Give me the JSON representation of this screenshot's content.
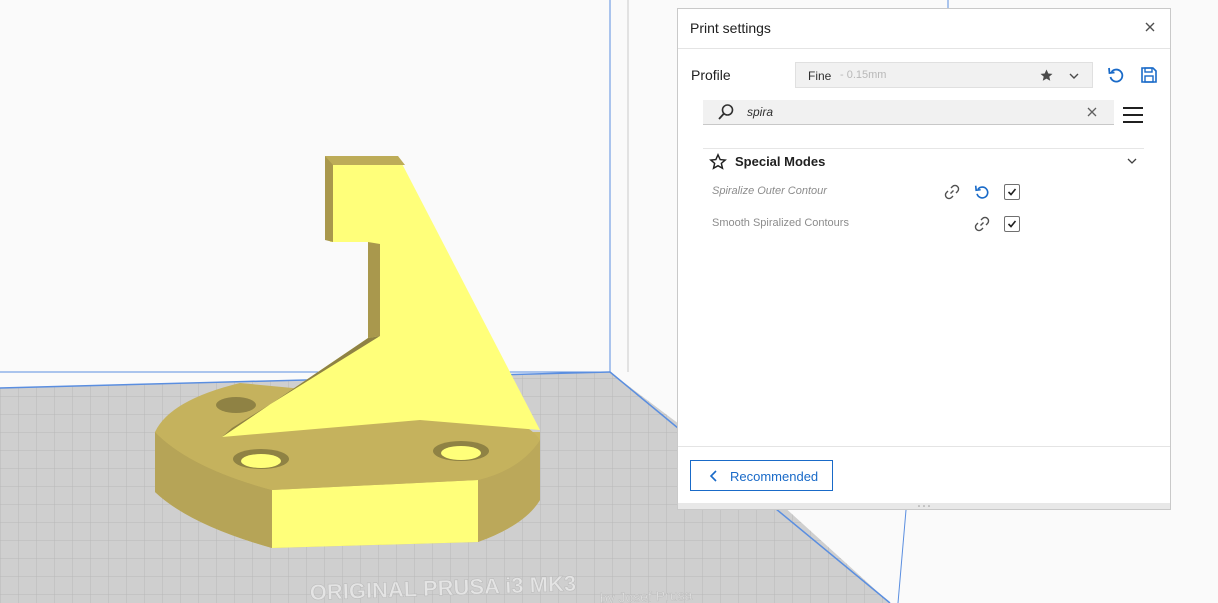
{
  "panel": {
    "title": "Print settings"
  },
  "profile": {
    "label": "Profile",
    "name": "Fine",
    "detail": "- 0.15mm"
  },
  "search": {
    "value": "spira",
    "placeholder": ""
  },
  "section": {
    "title": "Special Modes",
    "settings": [
      {
        "label": "Spiralize Outer Contour",
        "checked": true,
        "modified": true
      },
      {
        "label": "Smooth Spiralized Contours",
        "checked": true,
        "modified": false
      }
    ]
  },
  "footer": {
    "recommended_label": "Recommended"
  },
  "bed_label": {
    "line1": "ORIGINAL PRUSA i3 MK3",
    "line2": "by Josef Prusa"
  },
  "colors": {
    "accent": "#196ac8",
    "model_top": "#ffff7a",
    "model_side": "#c9b760",
    "bed": "#cfcfcf"
  },
  "icons": [
    "close-icon",
    "star-icon",
    "chevron-down-icon",
    "reset-icon",
    "save-icon",
    "search-icon",
    "menu-icon",
    "link-icon",
    "checkbox",
    "chevron-left-icon"
  ]
}
